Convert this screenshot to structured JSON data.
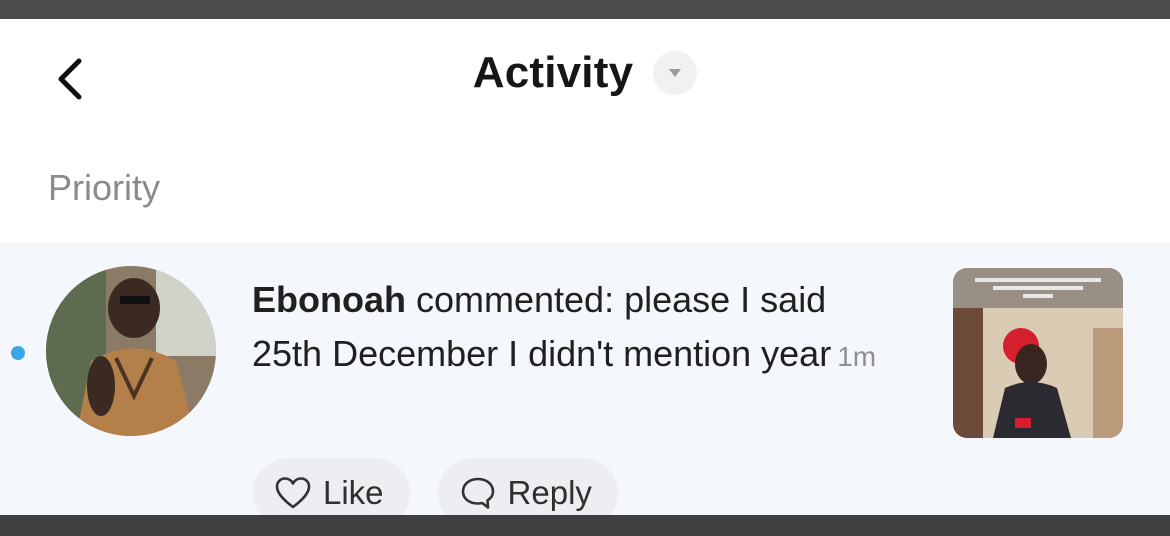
{
  "header": {
    "title": "Activity",
    "back_icon": "chevron-left-icon",
    "dropdown_icon": "caret-down-icon"
  },
  "section": {
    "label": "Priority"
  },
  "notification": {
    "unread": true,
    "unread_color": "#3ea6e6",
    "username": "Ebonoah",
    "message": " commented: please I said 25th December I didn't mention year",
    "time": "1m",
    "actions": {
      "like_label": "Like",
      "like_icon": "heart-outline-icon",
      "reply_label": "Reply",
      "reply_icon": "speech-bubble-icon"
    }
  }
}
